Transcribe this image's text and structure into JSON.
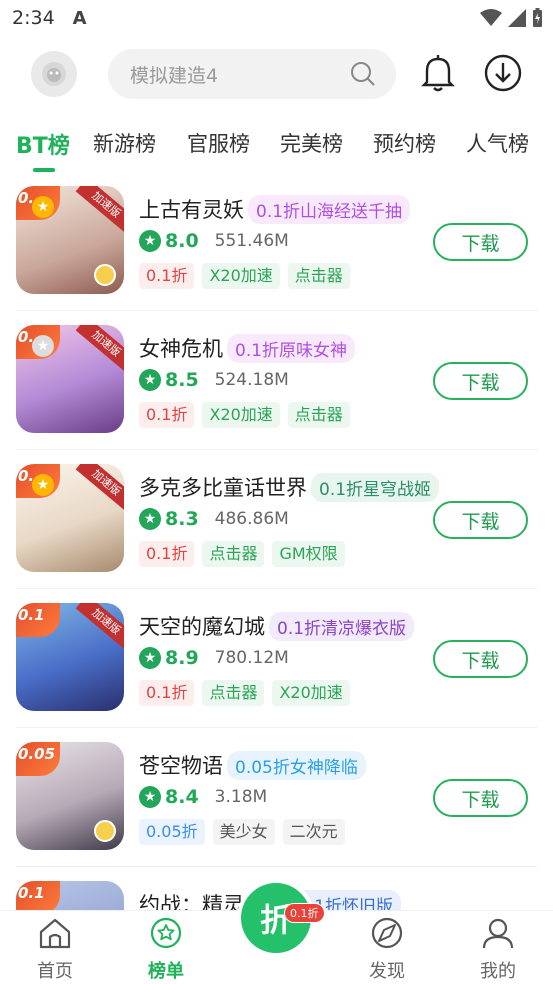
{
  "status": {
    "time": "2:34",
    "a_icon": "A"
  },
  "search": {
    "placeholder": "模拟建造4"
  },
  "tabs": [
    "BT榜",
    "新游榜",
    "官服榜",
    "完美榜",
    "预约榜",
    "人气榜"
  ],
  "colors": {
    "accent": "#20b25b",
    "promo_purple": "#b04fe0",
    "promo_teal": "#2a8f66",
    "promo_blue": "#2a9fe6"
  },
  "download_label": "下载",
  "games": [
    {
      "title": "上古有灵妖",
      "promo": "0.1折山海经送千抽",
      "score": "8.0",
      "size": "551.46M",
      "tags": [
        {
          "t": "0.1折",
          "c": "red"
        },
        {
          "t": "X20加速",
          "c": "green"
        },
        {
          "t": "点击器",
          "c": "green"
        }
      ],
      "thumb_corner": "0.",
      "ribbon": "加速版"
    },
    {
      "title": "女神危机",
      "promo": "0.1折原味女神",
      "score": "8.5",
      "size": "524.18M",
      "tags": [
        {
          "t": "0.1折",
          "c": "red"
        },
        {
          "t": "X20加速",
          "c": "green"
        },
        {
          "t": "点击器",
          "c": "green"
        }
      ],
      "thumb_corner": "0.",
      "ribbon": "加速版"
    },
    {
      "title": "多克多比童话世界",
      "promo": "0.1折星穹战姬",
      "score": "8.3",
      "size": "486.86M",
      "tags": [
        {
          "t": "0.1折",
          "c": "red"
        },
        {
          "t": "点击器",
          "c": "green"
        },
        {
          "t": "GM权限",
          "c": "green"
        }
      ],
      "thumb_corner": "0.",
      "ribbon": "加速版"
    },
    {
      "title": "天空的魔幻城",
      "promo": "0.1折清凉爆衣版",
      "score": "8.9",
      "size": "780.12M",
      "tags": [
        {
          "t": "0.1折",
          "c": "red"
        },
        {
          "t": "点击器",
          "c": "green"
        },
        {
          "t": "X20加速",
          "c": "green"
        }
      ],
      "thumb_corner": "0.1",
      "ribbon": "加速版"
    },
    {
      "title": "苍空物语",
      "promo": "0.05折女神降临",
      "score": "8.4",
      "size": "3.18M",
      "tags": [
        {
          "t": "0.05折",
          "c": "blue"
        },
        {
          "t": "美少女",
          "c": "gray"
        },
        {
          "t": "二次元",
          "c": "gray"
        }
      ],
      "thumb_corner": "0.05",
      "ribbon": ""
    },
    {
      "title": "约战：精灵再临",
      "promo": "0.1折怀旧版",
      "score": "",
      "size": "",
      "tags": [],
      "thumb_corner": "0.1",
      "ribbon": ""
    }
  ],
  "bottom_nav": {
    "home": "首页",
    "rank": "榜单",
    "center": "折",
    "center_badge": "0.1折",
    "discover": "发现",
    "mine": "我的"
  }
}
